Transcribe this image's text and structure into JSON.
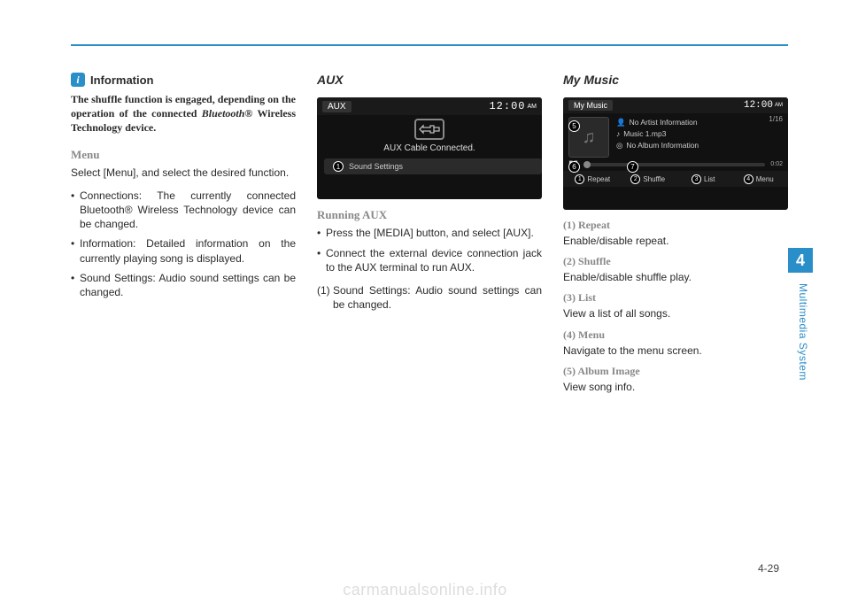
{
  "side": {
    "number": "4",
    "label": "Multimedia System"
  },
  "page_number": "4-29",
  "watermark": "carmanualsonline.info",
  "col1": {
    "info_label": "Information",
    "info_text_a": "The shuffle function is engaged, depend­ing on the operation of the connected ",
    "info_text_b": "Bluetooth",
    "info_text_c": "®",
    "info_text_d": " Wireless Technology device.",
    "menu_head": "Menu",
    "menu_intro": "Select [Menu], and select the desired function.",
    "menu_items": [
      "Connections: The currently connected Bluetooth® Wireless Technology device can be changed.",
      "Information: Detailed information on the currently playing song is displayed.",
      "Sound Settings: Audio sound set­tings can be changed."
    ]
  },
  "col2": {
    "heading": "AUX",
    "scr": {
      "title": "AUX",
      "clock": "12:00",
      "ampm": "AM",
      "msg": "AUX Cable Connected.",
      "ss": "Sound Settings"
    },
    "run_head": "Running AUX",
    "b1": "Press the [MEDIA] button, and select [AUX].",
    "b2": "Connect the external device con­nection jack to the AUX terminal to run AUX.",
    "n1": "Sound Settings: Audio sound set­tings can be changed."
  },
  "col3": {
    "heading": "My Music",
    "scr": {
      "title": "My Music",
      "clock": "12:00",
      "ampm": "AM",
      "track": "1/16",
      "line1": "No Artist Information",
      "line2": "Music 1.mp3",
      "line3": "No Album Information",
      "time": "0:02",
      "foot": {
        "f1": "Repeat",
        "f2": "Shuffle",
        "f3": "List",
        "f4": "Menu"
      }
    },
    "defs": [
      {
        "h": "(1) Repeat",
        "t": "Enable/disable repeat."
      },
      {
        "h": "(2) Shuffle",
        "t": "Enable/disable shuffle play."
      },
      {
        "h": "(3) List",
        "t": "View a list of all songs."
      },
      {
        "h": "(4) Menu",
        "t": "Navigate to the menu screen."
      },
      {
        "h": "(5) Album Image",
        "t": "View song info."
      }
    ]
  }
}
